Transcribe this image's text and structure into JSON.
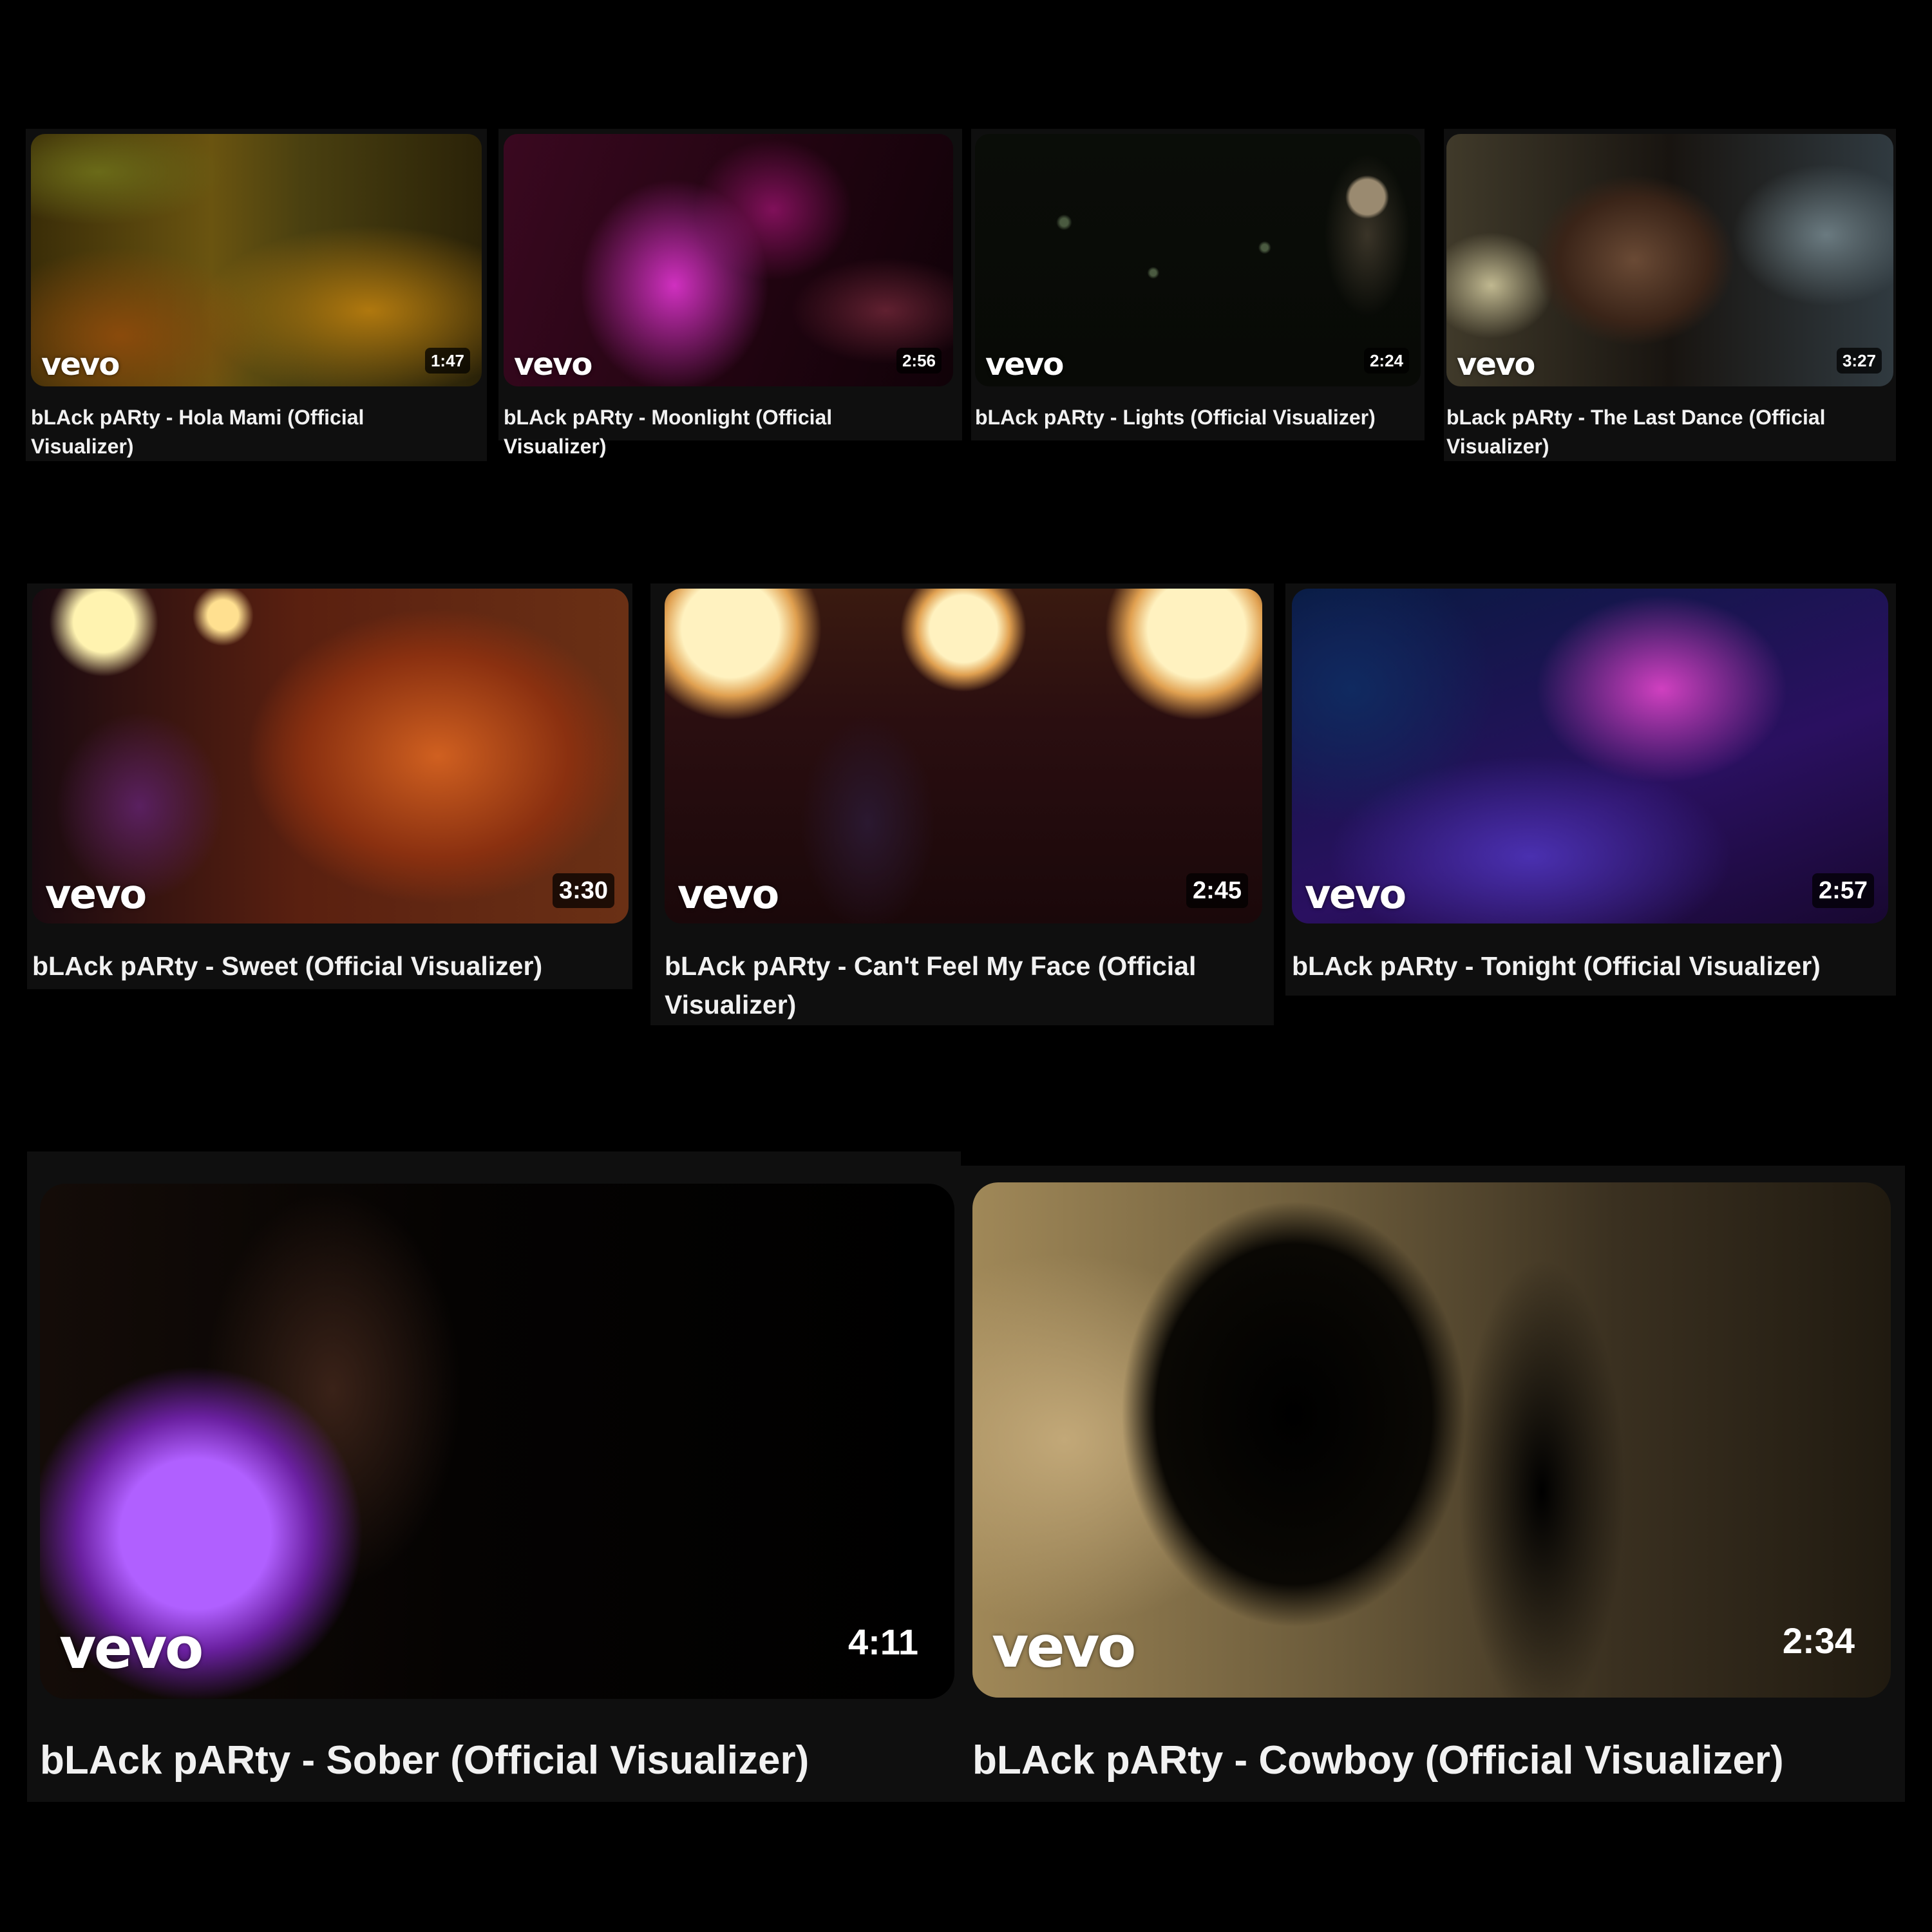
{
  "logo_text": "vevo",
  "videos": [
    {
      "title": "bLAck pARty - Hola Mami (Official Visualizer)",
      "duration": "1:47"
    },
    {
      "title": "bLAck pARty - Moonlight (Official Visualizer)",
      "duration": "2:56"
    },
    {
      "title": "bLAck pARty - Lights (Official Visualizer)",
      "duration": "2:24"
    },
    {
      "title": "bLack pARty - The Last Dance (Official Visualizer)",
      "duration": "3:27"
    },
    {
      "title": "bLAck pARty - Sweet (Official Visualizer)",
      "duration": "3:30"
    },
    {
      "title": "bLAck pARty - Can't Feel My Face (Official Visualizer)",
      "duration": "2:45"
    },
    {
      "title": "bLAck pARty - Tonight (Official Visualizer)",
      "duration": "2:57"
    },
    {
      "title": "bLAck pARty - Sober (Official Visualizer)",
      "duration": "4:11"
    },
    {
      "title": "bLAck pARty - Cowboy (Official Visualizer)",
      "duration": "2:34"
    }
  ],
  "icons": {
    "menu": "more-vert-icon"
  }
}
